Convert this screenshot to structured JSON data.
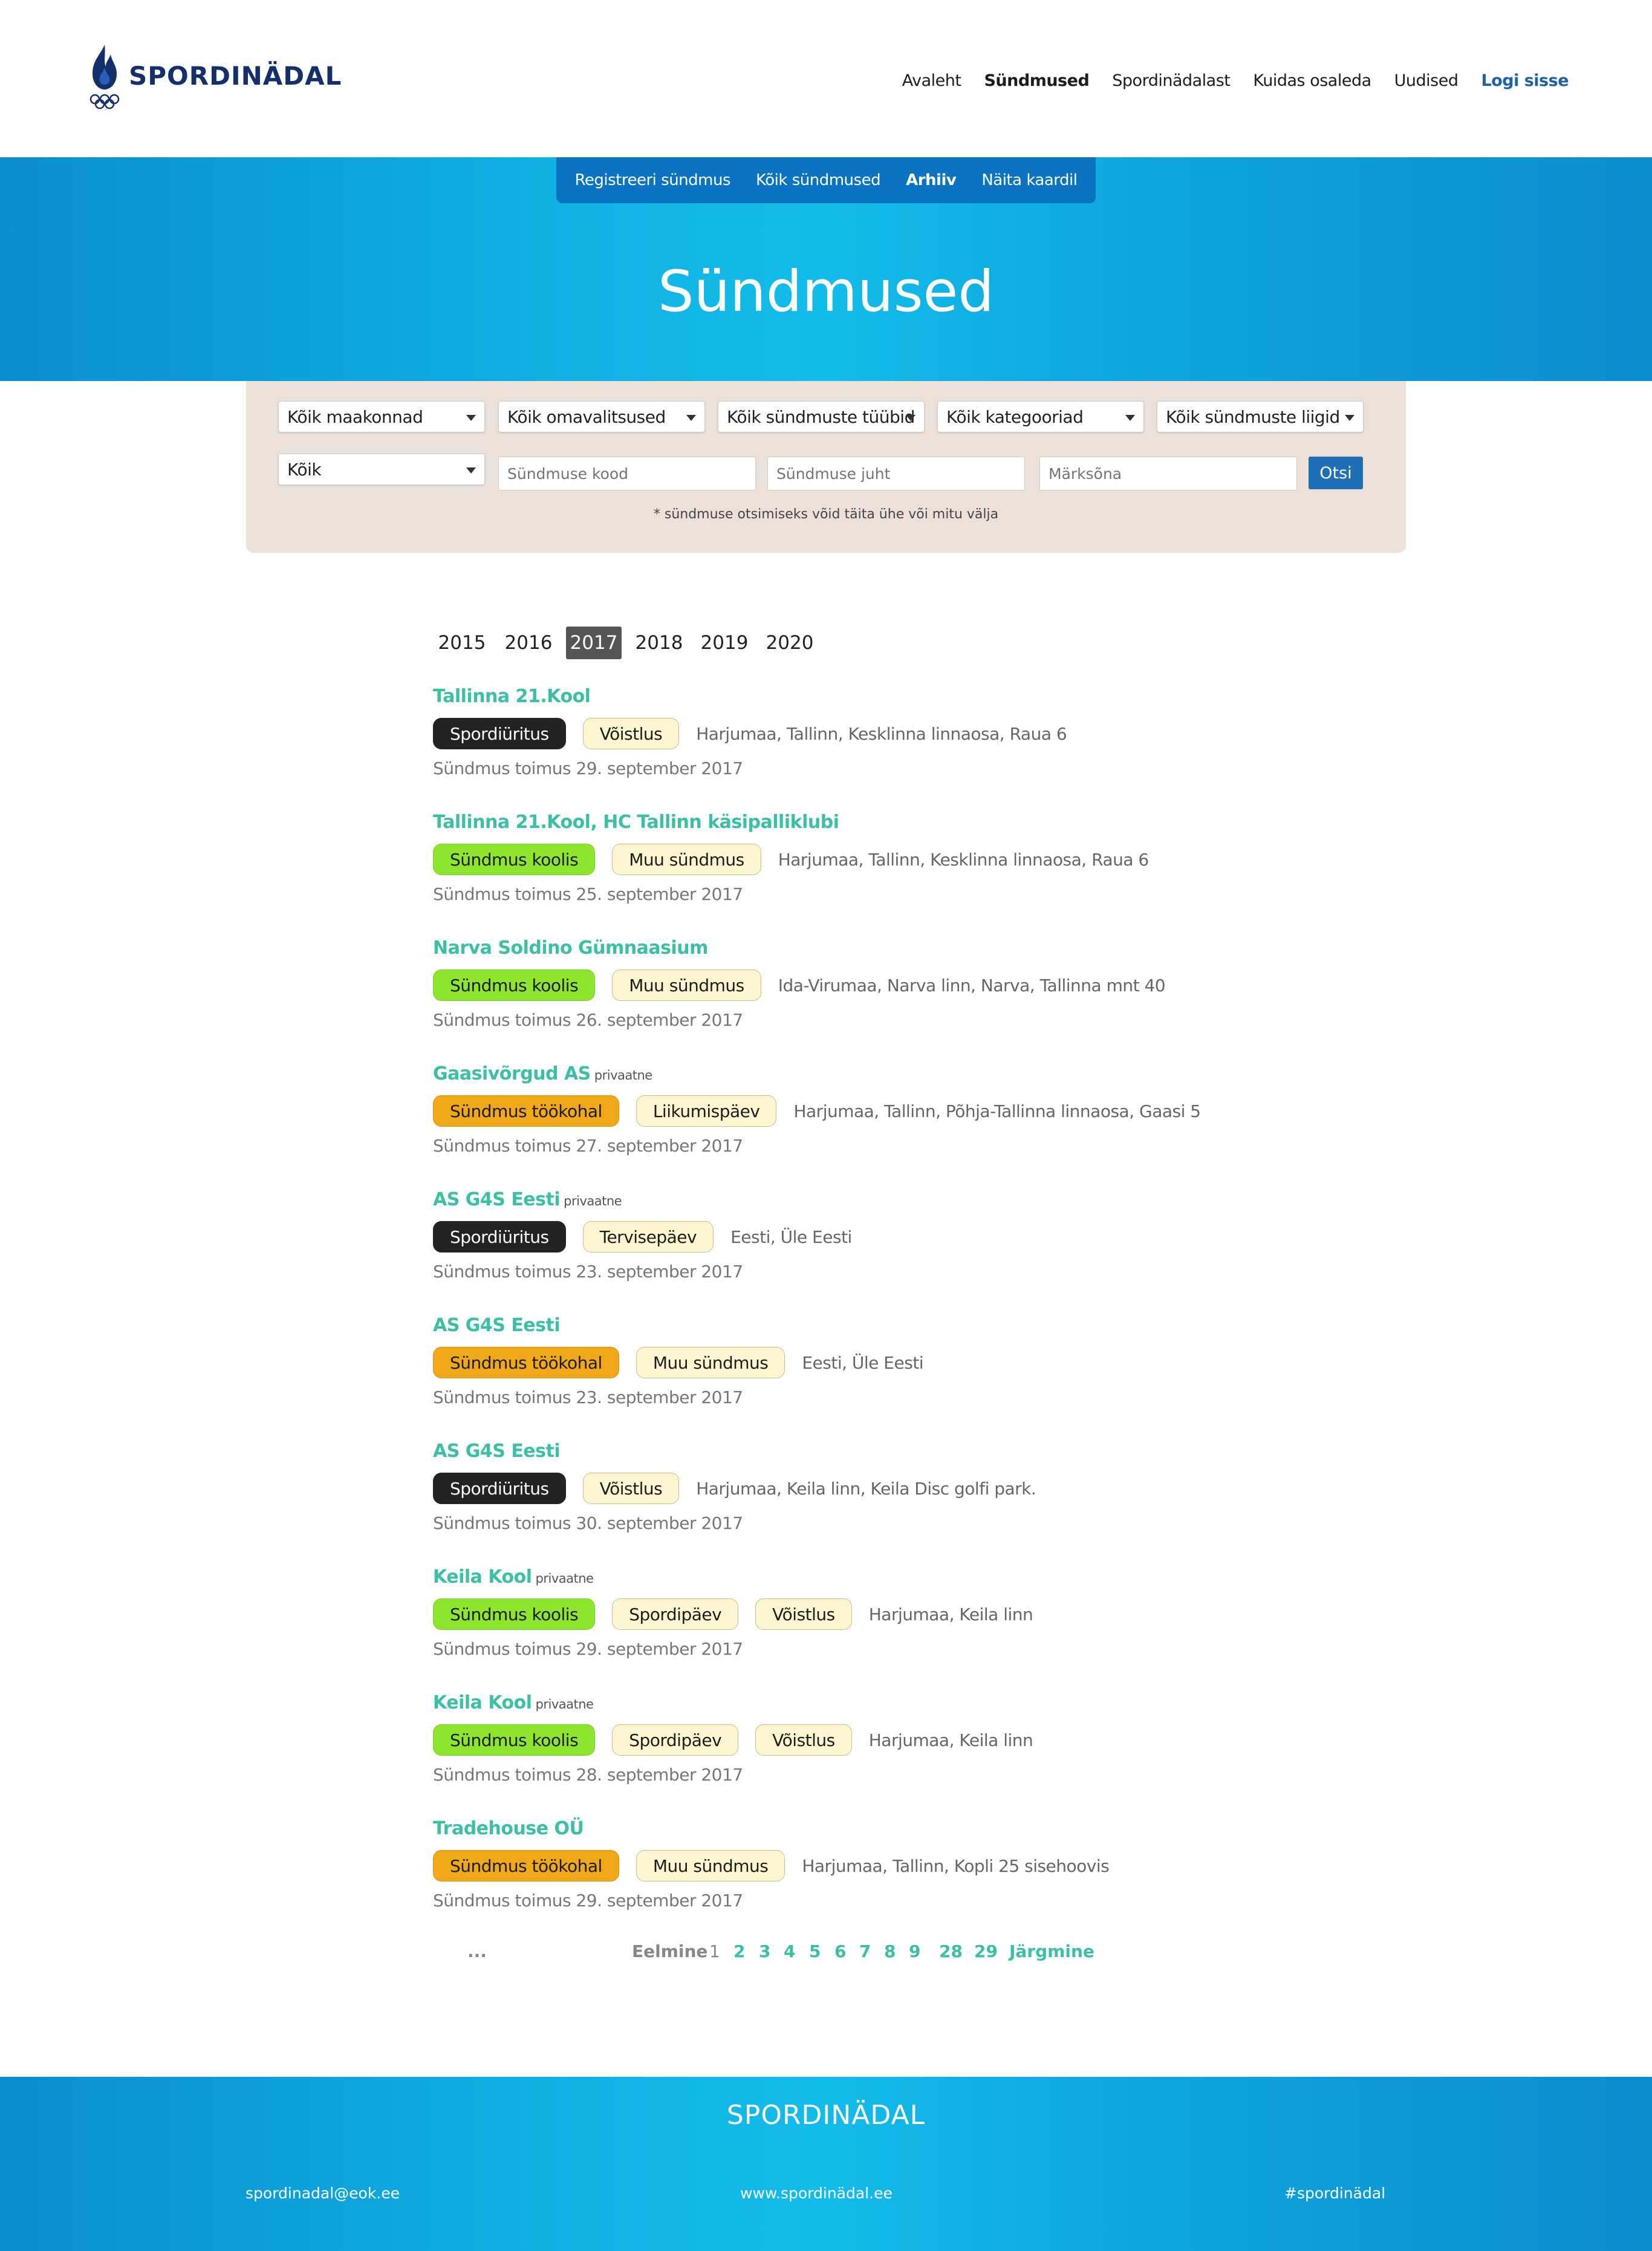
{
  "header": {
    "brand": "SPORDINÄDAL",
    "nav": [
      "Avaleht",
      "Sündmused",
      "Spordinädalast",
      "Kuidas osaleda",
      "Uudised"
    ],
    "login": "Logi sisse"
  },
  "subnav": [
    "Registreeri sündmus",
    "Kõik sündmused",
    "Arhiiv",
    "Näita kaardil"
  ],
  "hero": {
    "title": "Sündmused"
  },
  "filters": {
    "county": "Kõik maakonnad",
    "municipality": "Kõik omavalitsused",
    "event_type": "Kõik sündmuste tüübid",
    "category": "Kõik kategooriad",
    "event_kind": "Kõik sündmuste liigid",
    "all": "Kõik",
    "code_placeholder": "Sündmuse kood",
    "leader_placeholder": "Sündmuse juht",
    "keyword_placeholder": "Märksõna",
    "search_button": "Otsi",
    "note": "* sündmuse otsimiseks võid täita ühe või mitu välja"
  },
  "years": [
    "2015",
    "2016",
    "2017",
    "2018",
    "2019",
    "2020"
  ],
  "selected_year": "2017",
  "events": [
    {
      "title": "Tallinna 21.Kool",
      "private": "",
      "tags": [
        {
          "label": "Spordiüritus",
          "color": "black"
        },
        {
          "label": "Võistlus",
          "color": "cream"
        }
      ],
      "location": "Harjumaa, Tallinn, Kesklinna linnaosa, Raua 6",
      "date": "Sündmus toimus 29. september 2017"
    },
    {
      "title": "Tallinna 21.Kool, HC Tallinn käsipalliklubi",
      "private": "",
      "tags": [
        {
          "label": "Sündmus koolis",
          "color": "green"
        },
        {
          "label": "Muu sündmus",
          "color": "cream"
        }
      ],
      "location": "Harjumaa, Tallinn, Kesklinna linnaosa, Raua 6",
      "date": "Sündmus toimus 25. september 2017"
    },
    {
      "title": "Narva Soldino Gümnaasium",
      "private": "",
      "tags": [
        {
          "label": "Sündmus koolis",
          "color": "green"
        },
        {
          "label": "Muu sündmus",
          "color": "cream"
        }
      ],
      "location": "Ida-Virumaa, Narva linn, Narva, Tallinna mnt 40",
      "date": "Sündmus toimus 26. september 2017"
    },
    {
      "title": "Gaasivõrgud AS",
      "private": "privaatne",
      "tags": [
        {
          "label": "Sündmus töökohal",
          "color": "orange"
        },
        {
          "label": "Liikumispäev",
          "color": "cream"
        }
      ],
      "location": "Harjumaa, Tallinn, Põhja-Tallinna linnaosa, Gaasi 5",
      "date": "Sündmus toimus 27. september 2017"
    },
    {
      "title": "AS G4S Eesti",
      "private": "privaatne",
      "tags": [
        {
          "label": "Spordiüritus",
          "color": "black"
        },
        {
          "label": "Tervisepäev",
          "color": "cream"
        }
      ],
      "location": "Eesti, Üle Eesti",
      "date": "Sündmus toimus 23. september 2017"
    },
    {
      "title": "AS G4S Eesti",
      "private": "",
      "tags": [
        {
          "label": "Sündmus töökohal",
          "color": "orange"
        },
        {
          "label": "Muu sündmus",
          "color": "cream"
        }
      ],
      "location": "Eesti, Üle Eesti",
      "date": "Sündmus toimus 23. september 2017"
    },
    {
      "title": "AS G4S Eesti",
      "private": "",
      "tags": [
        {
          "label": "Spordiüritus",
          "color": "black"
        },
        {
          "label": "Võistlus",
          "color": "cream"
        }
      ],
      "location": "Harjumaa, Keila linn, Keila Disc golfi park.",
      "date": "Sündmus toimus 30. september 2017"
    },
    {
      "title": "Keila Kool",
      "private": "privaatne",
      "tags": [
        {
          "label": "Sündmus koolis",
          "color": "green"
        },
        {
          "label": "Spordipäev",
          "color": "cream"
        },
        {
          "label": "Võistlus",
          "color": "cream"
        }
      ],
      "location": "Harjumaa, Keila linn",
      "date": "Sündmus toimus 29. september 2017"
    },
    {
      "title": "Keila Kool",
      "private": "privaatne",
      "tags": [
        {
          "label": "Sündmus koolis",
          "color": "green"
        },
        {
          "label": "Spordipäev",
          "color": "cream"
        },
        {
          "label": "Võistlus",
          "color": "cream"
        }
      ],
      "location": "Harjumaa, Keila linn",
      "date": "Sündmus toimus 28. september 2017"
    },
    {
      "title": "Tradehouse OÜ",
      "private": "",
      "tags": [
        {
          "label": "Sündmus töökohal",
          "color": "orange"
        },
        {
          "label": "Muu sündmus",
          "color": "cream"
        }
      ],
      "location": "Harjumaa, Tallinn, Kopli 25 sisehoovis",
      "date": "Sündmus toimus 29. september 2017"
    }
  ],
  "pagination": {
    "ellipsis": "...",
    "prev": "Eelmine",
    "current": "1",
    "pages": [
      "2",
      "3",
      "4",
      "5",
      "6",
      "7",
      "8",
      "9",
      "28",
      "29"
    ],
    "next": "Järgmine"
  },
  "footer": {
    "title": "SPORDINÄDAL",
    "email": "spordinadal@eok.ee",
    "website": "www.spordinädal.ee",
    "hashtag": "#spordinädal"
  },
  "colors": {
    "accent": "#3bbfa5",
    "hero_blue": "#10b2e4",
    "subnav_blue": "#0a73c2",
    "tag_black": "#232323",
    "tag_green": "#8de52d",
    "tag_orange": "#f0a818",
    "tag_cream": "#fdf5cf"
  }
}
